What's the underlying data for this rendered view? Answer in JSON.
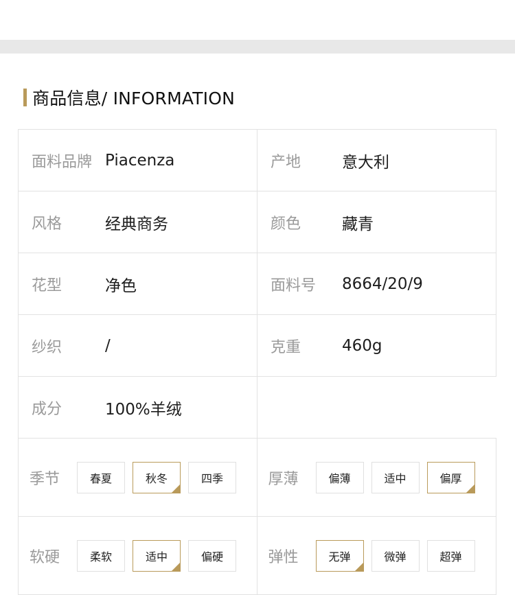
{
  "section": {
    "title": "商品信息/ INFORMATION"
  },
  "colors": {
    "accent": "#b99a5a",
    "label": "#9a9a9a",
    "band": "#e8e8e8"
  },
  "specs": [
    [
      {
        "label": "面料品牌",
        "value": "Piacenza"
      },
      {
        "label": "产地",
        "value": "意大利"
      }
    ],
    [
      {
        "label": "风格",
        "value": "经典商务"
      },
      {
        "label": "颜色",
        "value": "藏青"
      }
    ],
    [
      {
        "label": "花型",
        "value": "净色"
      },
      {
        "label": "面料号",
        "value": "8664/20/9"
      }
    ],
    [
      {
        "label": "纱织",
        "value": "/"
      },
      {
        "label": "克重",
        "value": "460g"
      }
    ],
    [
      {
        "label": "成分",
        "value": "100%羊绒"
      }
    ]
  ],
  "attributes": {
    "season": {
      "label": "季节",
      "options": [
        "春夏",
        "秋冬",
        "四季"
      ],
      "selected": "秋冬"
    },
    "thickness": {
      "label": "厚薄",
      "options": [
        "偏薄",
        "适中",
        "偏厚"
      ],
      "selected": "偏厚"
    },
    "softness": {
      "label": "软硬",
      "options": [
        "柔软",
        "适中",
        "偏硬"
      ],
      "selected": "适中"
    },
    "elasticity": {
      "label": "弹性",
      "options": [
        "无弹",
        "微弹",
        "超弹"
      ],
      "selected": "无弹"
    }
  }
}
